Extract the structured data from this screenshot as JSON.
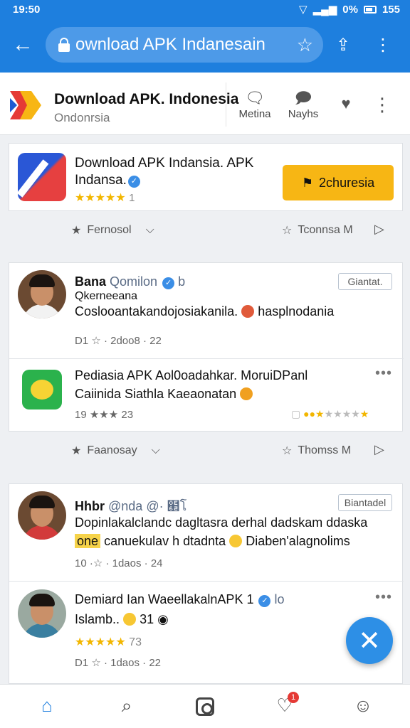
{
  "status": {
    "time": "19:50",
    "battery": "0%",
    "signal_text": "155"
  },
  "browser": {
    "url": "ownload APK Indanesain",
    "back_icon": "arrow-left-icon",
    "lock_icon": "lock-icon",
    "bookmark_icon": "star-outline-icon",
    "share_icon": "share-icon",
    "menu_icon": "more-vertical-icon"
  },
  "site": {
    "title": "Download APK. Indonesia",
    "subtitle": "Ondonrsia",
    "actions": [
      {
        "label": "Metina",
        "icon": "chat-icon"
      },
      {
        "label": "Nayhs",
        "icon": "comment-icon"
      }
    ],
    "badge_icon": "badge-icon",
    "more_icon": "more-vertical-icon"
  },
  "app_card": {
    "title_line1": "Download APK Indansia. APK",
    "title_line2": "Indansa.",
    "rating_count": "1",
    "download_label": "2churesia"
  },
  "filters": [
    {
      "left_label": "Fernosol",
      "right_label": "Tconnsa M"
    },
    {
      "left_label": "Faanosay",
      "right_label": "Thomss M"
    }
  ],
  "posts": [
    {
      "name": "Bana",
      "handle": "Qomilon",
      "handle_suffix": "b",
      "tag": "Giantat.",
      "line1": "Qkerneeana",
      "line2": "Coslooantakandojosiakanila.",
      "line2b": "hasplnodania",
      "meta": "D1 ☆ · 2doo8 · 22"
    },
    {
      "name": "Pediasia APK Aol0oadahkar. MoruiDPanl",
      "line1": "Caiinida Siathla Kaeaonatan",
      "meta": "19 ★★★ 23"
    },
    {
      "name": "Hhbr",
      "handle": "@nda",
      "handle_suffix": "@· ๢โ",
      "tag": "Biantadel",
      "line1": "Dopinlakalclandc dagltasra derhal dadskam ddaska",
      "highlight": "one",
      "line2": "canuekulav h dtadnta",
      "line2b": "Diaben'alagnolims",
      "meta": "10 ·☆ · 1daos · 24"
    },
    {
      "name": "Demiard Ian WaeellakalnAPK 1",
      "handle_suffix": "lo",
      "line1": "Islamb..",
      "line1b": "31",
      "rating_count": "73",
      "meta": "D1 ☆ · 1daos · 22"
    }
  ],
  "fab_icon": "close-icon",
  "bottom_nav": [
    {
      "name": "home",
      "icon": "home-icon"
    },
    {
      "name": "search",
      "icon": "search-icon"
    },
    {
      "name": "instagram",
      "icon": "instagram-icon"
    },
    {
      "name": "favorites",
      "icon": "heart-icon",
      "badge": "1"
    },
    {
      "name": "profile",
      "icon": "user-icon"
    }
  ],
  "colors": {
    "primary": "#1e7fde",
    "download_button": "#f7b614",
    "star": "#f2b600"
  }
}
